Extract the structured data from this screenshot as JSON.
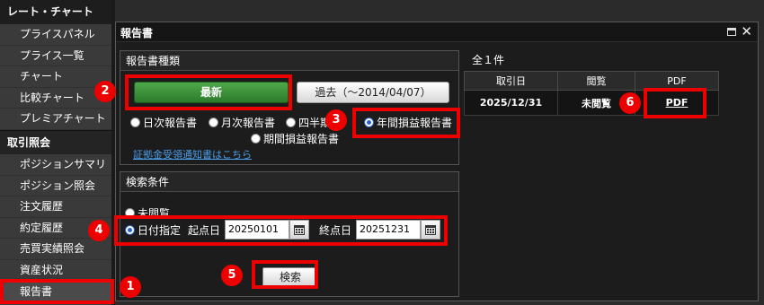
{
  "sidebar": {
    "section_rate": "レート・チャート",
    "rate_items": [
      "プライスパネル",
      "プライス一覧",
      "チャート",
      "比較チャート",
      "プレミアチャート"
    ],
    "section_trade": "取引照会",
    "trade_items": [
      "ポジションサマリ",
      "ポジション照会",
      "注文履歴",
      "約定履歴",
      "売買実績照会",
      "資産状況",
      "報告書"
    ]
  },
  "dialog": {
    "title": "報告書",
    "type_panel": {
      "header": "報告書種類",
      "latest_button": "最新",
      "past_button": "過去（～2014/04/07）",
      "radio_daily": "日次報告書",
      "radio_monthly": "月次報告書",
      "radio_quarterly": "四半期",
      "radio_annual": "年間損益報告書",
      "radio_period": "期間損益報告書",
      "link_notice": "証拠金受領通知書はこちら"
    },
    "search_panel": {
      "header": "検索条件",
      "radio_unread": "未閲覧",
      "radio_date": "日付指定",
      "start_label": "起点日",
      "start_value": "20250101",
      "end_label": "終点日",
      "end_value": "20251231",
      "search_button": "検索"
    },
    "results": {
      "count": "全１件",
      "headers": [
        "取引日",
        "閲覧",
        "PDF"
      ],
      "rows": [
        {
          "date": "2025/12/31",
          "status": "未閲覧",
          "pdf": "PDF"
        }
      ]
    }
  },
  "markers": [
    "1",
    "2",
    "3",
    "4",
    "5",
    "6"
  ],
  "colors": {
    "highlight": "#e00000",
    "latest_button": "#3a923a",
    "radio_selected": "#2a62c9",
    "link": "#4a9de8"
  }
}
